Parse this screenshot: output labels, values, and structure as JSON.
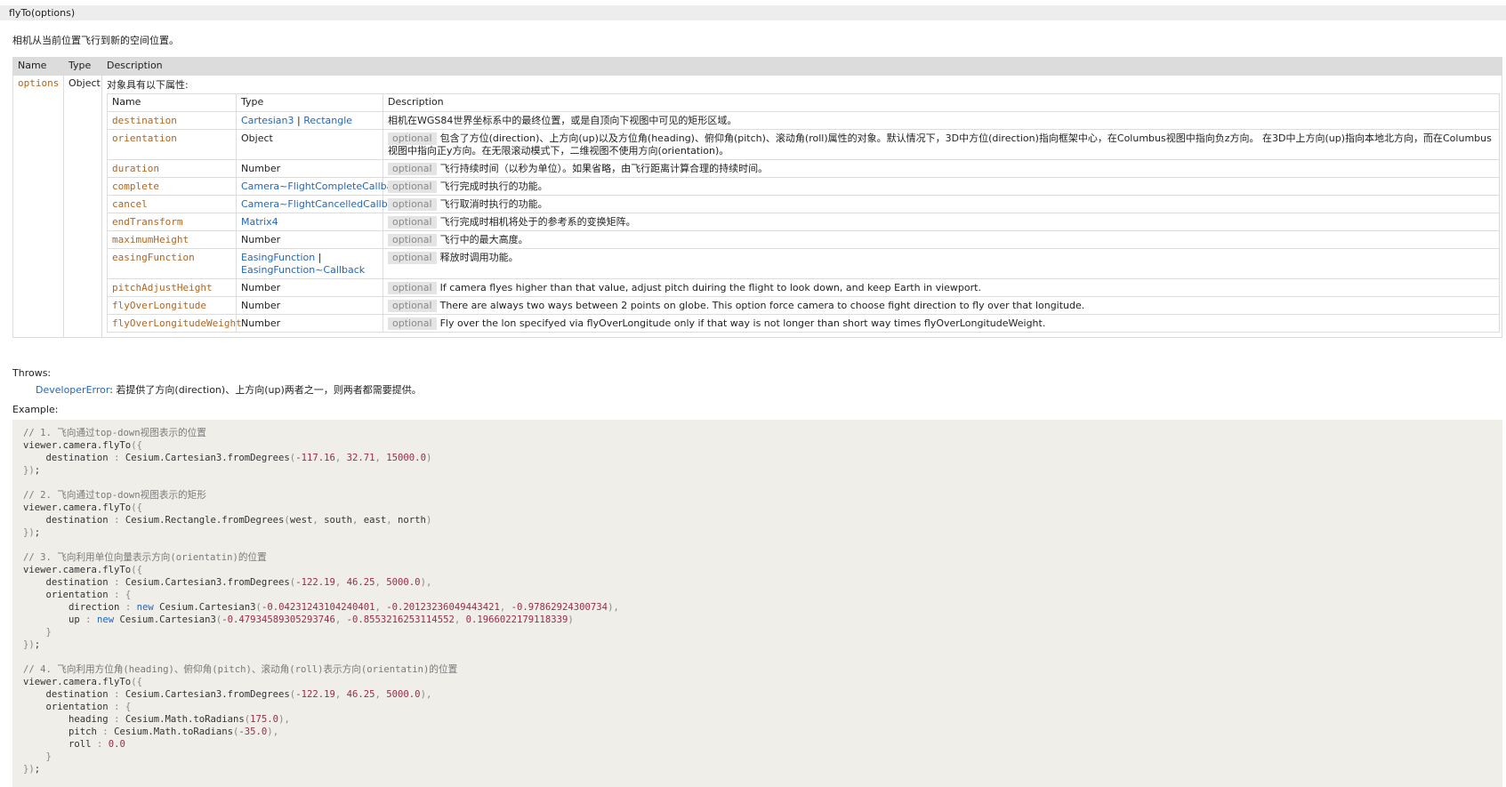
{
  "signature": "flyTo(options)",
  "summary": "相机从当前位置飞行到新的空间位置。",
  "params_table": {
    "headers": [
      "Name",
      "Type",
      "Description"
    ],
    "param_name": "options",
    "param_type": "Object",
    "param_desc": "对象具有以下属性:",
    "inner_headers": [
      "Name",
      "Type",
      "Description"
    ],
    "optional_label": "optional",
    "rows": [
      {
        "name": "destination",
        "type": "Cartesian3 | Rectangle",
        "optional": false,
        "desc": "相机在WGS84世界坐标系中的最终位置，或是自顶向下视图中可见的矩形区域。"
      },
      {
        "name": "orientation",
        "type": "Object",
        "optional": true,
        "desc": "包含了方位(direction)、上方向(up)以及方位角(heading)、俯仰角(pitch)、滚动角(roll)属性的对象。默认情况下，3D中方位(direction)指向框架中心，在Columbus视图中指向负z方向。 在3D中上方向(up)指向本地北方向，而在Columbus视图中指向正y方向。在无限滚动模式下，二维视图不使用方向(orientation)。"
      },
      {
        "name": "duration",
        "type": "Number",
        "optional": true,
        "desc": "飞行持续时间（以秒为单位）。如果省略，由飞行距离计算合理的持续时间。"
      },
      {
        "name": "complete",
        "type": "Camera~FlightCompleteCallback",
        "optional": true,
        "desc": "飞行完成时执行的功能。"
      },
      {
        "name": "cancel",
        "type": "Camera~FlightCancelledCallback",
        "optional": true,
        "desc": "飞行取消时执行的功能。"
      },
      {
        "name": "endTransform",
        "type": "Matrix4",
        "optional": true,
        "desc": "飞行完成时相机将处于的参考系的变换矩阵。"
      },
      {
        "name": "maximumHeight",
        "type": "Number",
        "optional": true,
        "desc": "飞行中的最大高度。"
      },
      {
        "name": "easingFunction",
        "type": "EasingFunction | EasingFunction~Callback",
        "optional": true,
        "desc": "释放时调用功能。"
      },
      {
        "name": "pitchAdjustHeight",
        "type": "Number",
        "optional": true,
        "desc": "If camera flyes higher than that value, adjust pitch duiring the flight to look down, and keep Earth in viewport."
      },
      {
        "name": "flyOverLongitude",
        "type": "Number",
        "optional": true,
        "desc": "There are always two ways between 2 points on globe. This option force camera to choose fight direction to fly over that longitude."
      },
      {
        "name": "flyOverLongitudeWeight",
        "type": "Number",
        "optional": true,
        "desc": "Fly over the lon specifyed via flyOverLongitude only if that way is not longer than short way times flyOverLongitudeWeight."
      }
    ]
  },
  "throws": {
    "label": "Throws:",
    "error_type": "DeveloperError",
    "error_desc": ": 若提供了方向(direction)、上方向(up)两者之一，则两者都需要提供。"
  },
  "example": {
    "label": "Example:",
    "code": [
      "// 1. 飞向通过top-down视图表示的位置",
      "viewer.camera.flyTo({",
      "    destination : Cesium.Cartesian3.fromDegrees(-117.16, 32.71, 15000.0)",
      "});",
      "",
      "// 2. 飞向通过top-down视图表示的矩形",
      "viewer.camera.flyTo({",
      "    destination : Cesium.Rectangle.fromDegrees(west, south, east, north)",
      "});",
      "",
      "// 3. 飞向利用单位向量表示方向(orientatin)的位置",
      "viewer.camera.flyTo({",
      "    destination : Cesium.Cartesian3.fromDegrees(-122.19, 46.25, 5000.0),",
      "    orientation : {",
      "        direction : new Cesium.Cartesian3(-0.04231243104240401, -0.20123236049443421, -0.97862924300734),",
      "        up : new Cesium.Cartesian3(-0.47934589305293746, -0.8553216253114552, 0.1966022179118339)",
      "    }",
      "});",
      "",
      "// 4. 飞向利用方位角(heading)、俯仰角(pitch)、滚动角(roll)表示方向(orientatin)的位置",
      "viewer.camera.flyTo({",
      "    destination : Cesium.Cartesian3.fromDegrees(-122.19, 46.25, 5000.0),",
      "    orientation : {",
      "        heading : Cesium.Math.toRadians(175.0),",
      "        pitch : Cesium.Math.toRadians(-35.0),",
      "        roll : 0.0",
      "    }",
      "});"
    ]
  }
}
